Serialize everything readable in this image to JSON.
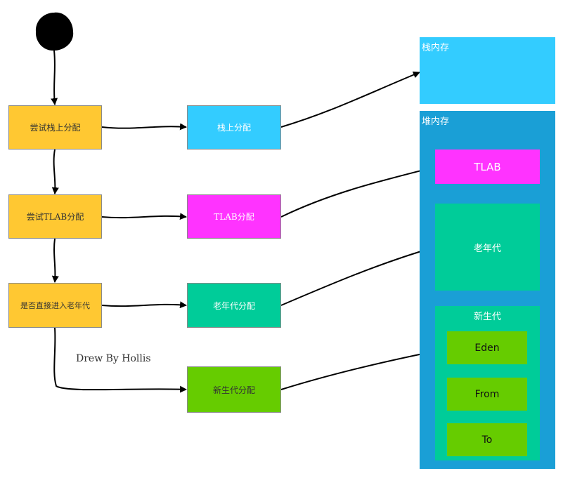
{
  "colors": {
    "yellow": "#ffc832",
    "stack": "#33ccff",
    "heap": "#1a9fd6",
    "tlab": "#ff33ff",
    "old": "#00cc99",
    "young": "#66cc00",
    "start": "#000000"
  },
  "flow": {
    "steps": [
      "尝试栈上分配",
      "尝试TLAB分配",
      "是否直接进入老年代"
    ],
    "targets": [
      "栈上分配",
      "TLAB分配",
      "老年代分配",
      "新生代分配"
    ]
  },
  "memory": {
    "stack": "栈内存",
    "heap": "堆内存",
    "tlab": "TLAB",
    "old": "老年代",
    "young": "新生代",
    "eden": "Eden",
    "from": "From",
    "to": "To"
  },
  "credit": "Drew By Hollis"
}
